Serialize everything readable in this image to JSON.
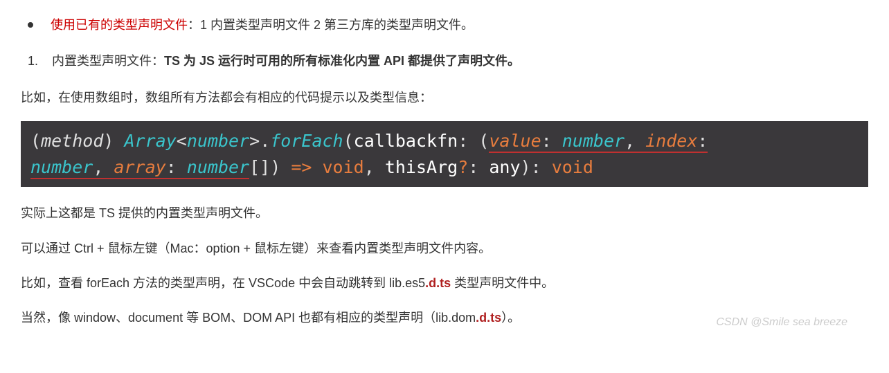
{
  "bullet": {
    "highlight": "使用已有的类型声明文件",
    "rest": "：1 内置类型声明文件 2 第三方库的类型声明文件。"
  },
  "numbered": {
    "num": "1.",
    "prefix": "内置类型声明文件：",
    "bold": "TS 为 JS 运行时可用的所有标准化内置 API 都提供了声明文件。"
  },
  "para1": "比如，在使用数组时，数组所有方法都会有相应的代码提示以及类型信息：",
  "code": {
    "t1": "(",
    "t2": "method",
    "t3": ") ",
    "t4": "Array",
    "t5": "<",
    "t6": "number",
    "t7": ">",
    "t8": ".",
    "t9": "forEach",
    "t10": "(",
    "t11": "callbackfn",
    "t12": ":",
    "t13": " (",
    "t14": "value",
    "t15": ": ",
    "t16": "number",
    "t17": ", ",
    "t18": "index",
    "t19": ": ",
    "t20": "number",
    "t21": ", ",
    "t22": "array",
    "t23": ": ",
    "t24": "number",
    "t25": "[]",
    "t26": ") ",
    "t27": "=>",
    "t28": " ",
    "t29": "void",
    "t30": ", ",
    "t31": "thisArg",
    "t32": "?",
    "t33": ":",
    "t34": " any",
    "t35": "):",
    "t36": " ",
    "t37": "void"
  },
  "para2": "实际上这都是 TS 提供的内置类型声明文件。",
  "para3": "可以通过 Ctrl + 鼠标左键（Mac：option + 鼠标左键）来查看内置类型声明文件内容。",
  "para4_a": "比如，查看 forEach 方法的类型声明，在 VSCode 中会自动跳转到 lib.es5",
  "para4_b": ".d.ts",
  "para4_c": " 类型声明文件中。",
  "para5_a": "当然，像 window、document 等 BOM、DOM API 也都有相应的类型声明（lib.dom",
  "para5_b": ".d.ts",
  "para5_c": "）。",
  "watermark": "CSDN @Smile sea breeze"
}
